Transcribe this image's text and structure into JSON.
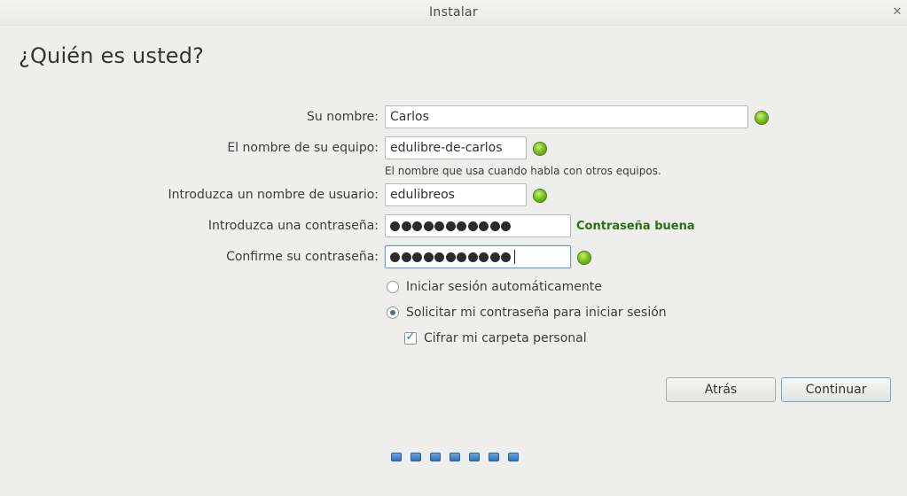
{
  "window": {
    "title": "Instalar",
    "close_icon": "close-icon"
  },
  "page": {
    "heading": "¿Quién es usted?"
  },
  "form": {
    "name": {
      "label": "Su nombre:",
      "value": "Carlos"
    },
    "computer": {
      "label": "El nombre de su equipo:",
      "value": "edulibre-de-carlos",
      "hint": "El nombre que usa cuando habla con otros equipos."
    },
    "username": {
      "label": "Introduzca un nombre de usuario:",
      "value": "edulibreos"
    },
    "password": {
      "label": "Introduzca una contraseña:",
      "masked_length": 11,
      "strength": "Contraseña buena"
    },
    "confirm": {
      "label": "Confirme su contraseña:",
      "masked_length": 11
    },
    "options": {
      "auto_login": {
        "label": "Iniciar sesión automáticamente",
        "selected": false
      },
      "require_password": {
        "label": "Solicitar mi contraseña para iniciar sesión",
        "selected": true
      },
      "encrypt_home": {
        "label": "Cifrar mi carpeta personal",
        "checked": true
      }
    }
  },
  "buttons": {
    "back": "Atrás",
    "continue": "Continuar"
  },
  "progress": {
    "steps": 7
  },
  "colors": {
    "ok_green": "#7cc21f",
    "strength_text": "#2d6f0f",
    "progress_blue": "#2f73b9",
    "focus_border": "#6b9bd2"
  }
}
